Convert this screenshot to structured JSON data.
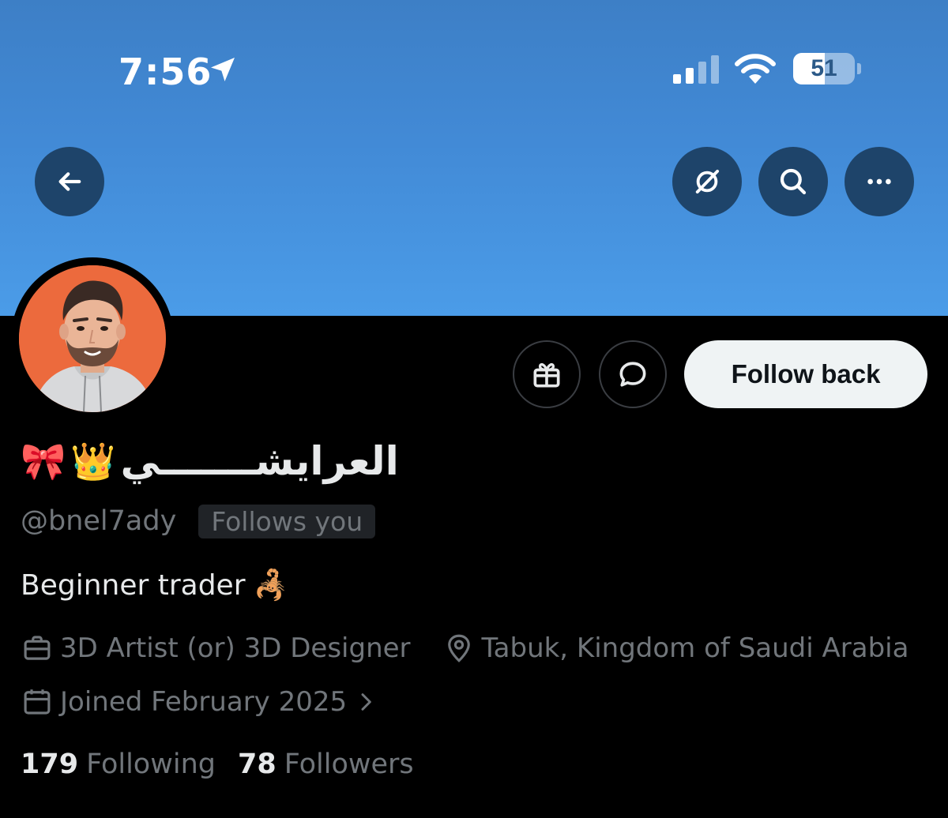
{
  "status_bar": {
    "time": "7:56",
    "battery": "51",
    "battery_level": 0.51
  },
  "header": {
    "back_icon": "arrow-left-icon",
    "grok_icon": "grok-icon",
    "search_icon": "search-icon",
    "more_icon": "more-icon"
  },
  "profile": {
    "display_name": "العرايشـــــــي",
    "name_emojis": [
      "👑",
      "🎀"
    ],
    "handle": "@bnel7ady",
    "follows_you": "Follows you",
    "bio": "Beginner trader",
    "bio_emoji": "🦂",
    "profession": "3D Artist (or) 3D Designer",
    "location": "Tabuk, Kingdom of Saudi Arabia",
    "joined": "Joined February 2025",
    "following_count": "179",
    "following_label": "Following",
    "followers_count": "78",
    "followers_label": "Followers"
  },
  "actions": {
    "gift_icon": "gift-icon",
    "message_icon": "message-icon",
    "follow_label": "Follow back"
  },
  "colors": {
    "banner": "#4b9ce8",
    "button_dark": "#1e446a",
    "avatar_bg": "#ec6a3d",
    "muted_text": "#71767b"
  }
}
